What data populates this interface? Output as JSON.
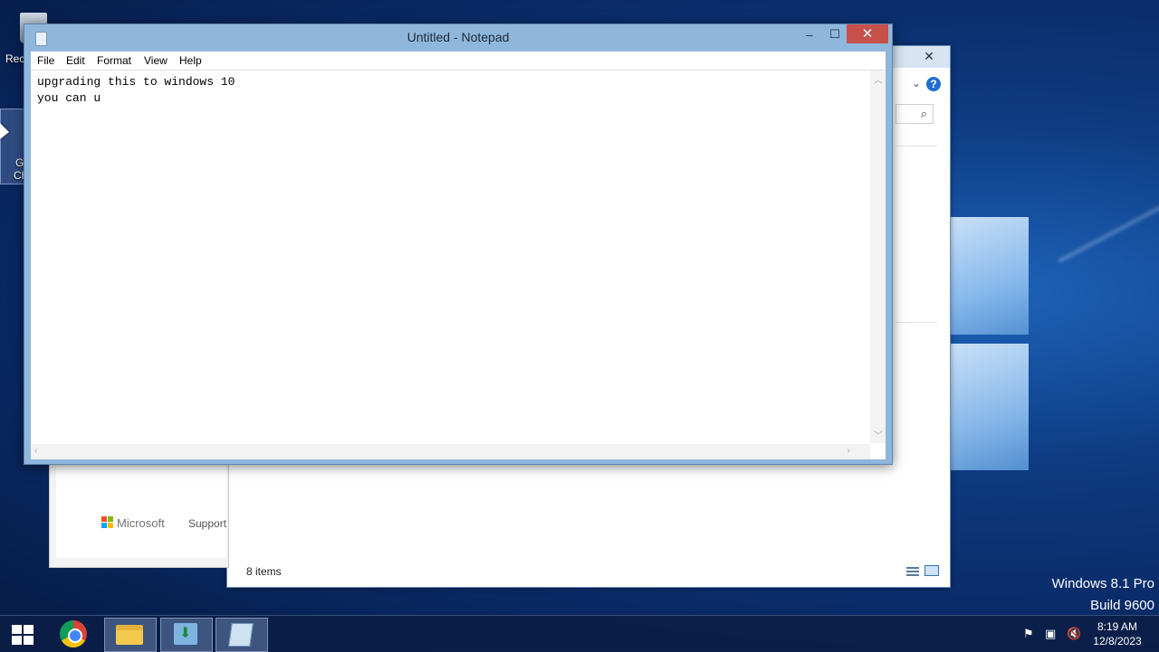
{
  "notepad": {
    "title": "Untitled - Notepad",
    "controls": {
      "minimize": "–",
      "maximize": "☐",
      "close": "✕"
    },
    "menu": [
      "File",
      "Edit",
      "Format",
      "View",
      "Help"
    ],
    "content_lines": [
      "upgrading this to windows 10",
      "you can u"
    ]
  },
  "desktop": {
    "recycle_bin_label": "Rec",
    "chrome_label_1": "G",
    "chrome_label_2": "Ch"
  },
  "explorer": {
    "status": "8 items",
    "help": "?",
    "close": "✕"
  },
  "support_window": {
    "brand": "Microsoft",
    "link": "Support"
  },
  "watermark": {
    "line1": "Windows 8.1 Pro",
    "line2": "Build 9600"
  },
  "taskbar": {
    "apps": [
      "start-icon",
      "chrome-icon",
      "file-explorer-icon",
      "download-icon",
      "notepad-icon"
    ],
    "clock_time": "8:19 AM",
    "clock_date": "12/8/2023"
  },
  "colors": {
    "notepad_frame": "#8fb7dc",
    "close_button": "#c7504a",
    "taskbar": "#0a1e46"
  }
}
